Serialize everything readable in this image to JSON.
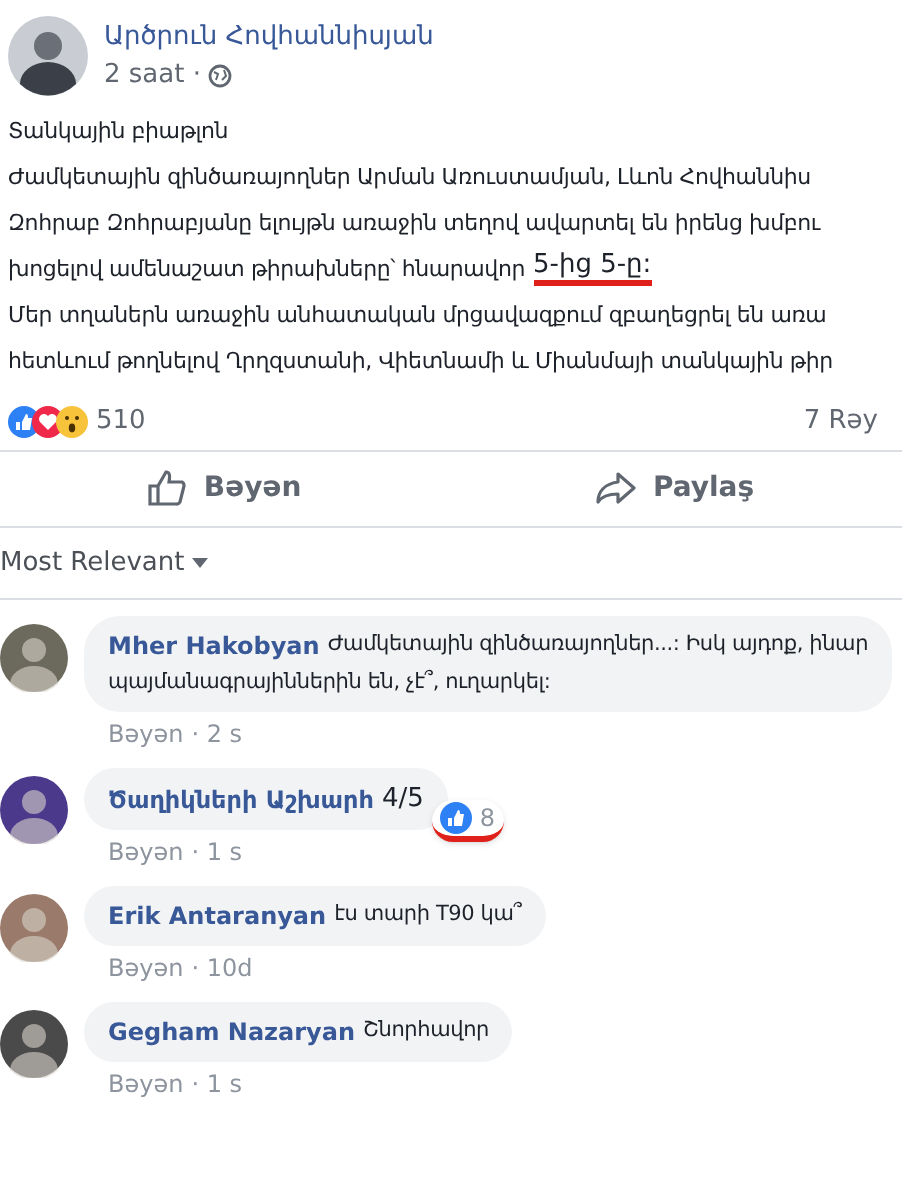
{
  "post": {
    "author": "Արծրուն Հովհաննիսյան",
    "time": "2 saat ·",
    "lines": [
      {
        "text": "Տանկային բիաթլոն"
      },
      {
        "text": "Ժամկետային զինծառայողներ Արման Առուստամյան, Լևոն Հովհաննիս"
      },
      {
        "text": "Զոհրաբ Զոհրաբյանը ելույթն առաջին տեղով ավարտել են իրենց խմբու"
      },
      {
        "text": "խոցելով ամենաշատ թիրախները՝ հնարավոր",
        "highlight": "5-ից 5-ը:"
      },
      {
        "text": "Մեր տղաներն առաջին անհատական մրցավազքում զբաղեցրել են առա"
      },
      {
        "text": "հետևում թողնելով Ղրղզստանի, Վիետնամի և Միանմայի տանկային թիր"
      }
    ],
    "reaction_count": "510",
    "comment_count": "7 Rəy",
    "actions": [
      {
        "kind": "like",
        "label": "Bəyən"
      },
      {
        "kind": "share",
        "label": "Paylaş"
      }
    ]
  },
  "sort": "Most Relevant",
  "comments": [
    {
      "author": "Mher Hakobyan",
      "text": "Ժամկետային զինծառայողներ...: Իսկ այդոք, ինար",
      "text_2": "պայմանագրայիններին են, չէ՞, ուղարկել:",
      "like": "Bəyən",
      "time": "· 2 s"
    },
    {
      "author": "Ծաղիկների Աշխարհ",
      "highlight": "4/5",
      "likes": "8",
      "like": "Bəyən",
      "time": "· 1 s"
    },
    {
      "author": "Erik Antaranyan",
      "text": "էս տարի T90 կա՞",
      "like": "Bəyən",
      "time": "· 10d"
    },
    {
      "author": "Gegham Nazaryan",
      "text": "Շնորհավոր",
      "like": "Bəyən",
      "time": "· 1 s"
    }
  ]
}
